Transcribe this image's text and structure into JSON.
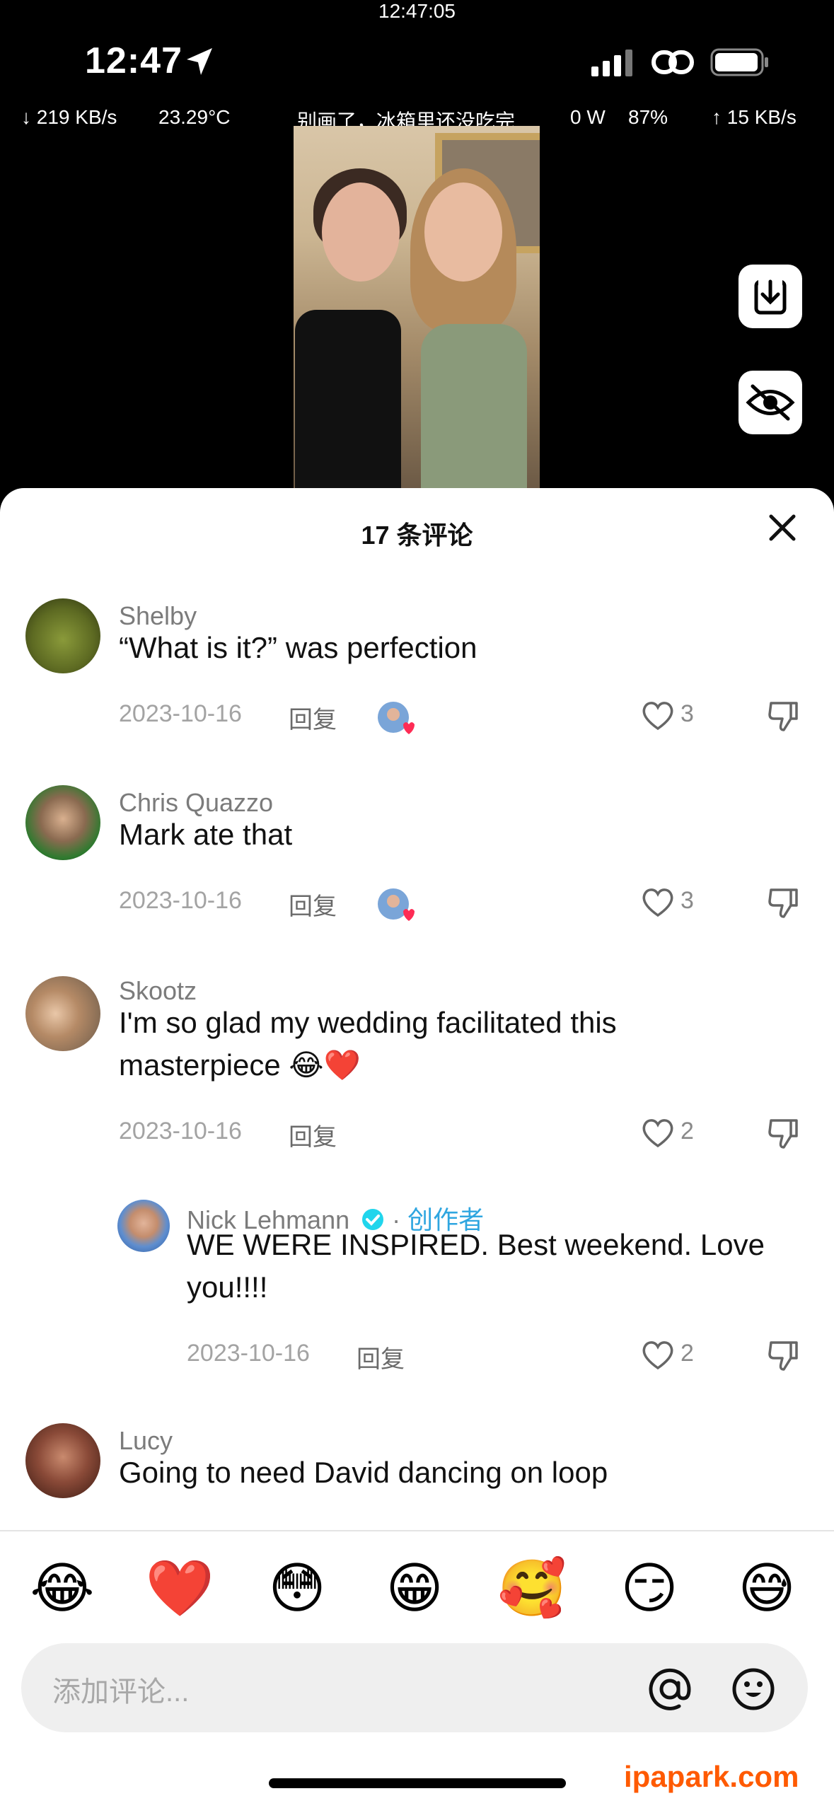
{
  "system_clock": "12:47:05",
  "status": {
    "time": "12:47",
    "location_icon": "location-arrow-icon"
  },
  "overlay": {
    "download_speed": "219 KB/s",
    "temperature": "23.29°C",
    "title": "别画了，冰箱里还没吃完",
    "power": "0 W",
    "battery_percent": "87%",
    "upload_speed": "15 KB/s"
  },
  "sheet": {
    "title": "17 条评论"
  },
  "comments": [
    {
      "user": "Shelby",
      "text": "“What is it?” was perfection",
      "date": "2023-10-16",
      "reply": "回复",
      "likes": "3"
    },
    {
      "user": "Chris Quazzo",
      "text": "Mark ate that",
      "date": "2023-10-16",
      "reply": "回复",
      "likes": "3"
    },
    {
      "user": "Skootz",
      "text": "I'm so glad my wedding facilitated this masterpiece 😂❤️",
      "date": "2023-10-16",
      "reply": "回复",
      "likes": "2"
    },
    {
      "user": "Nick Lehmann",
      "separator": "·",
      "creator_tag": "创作者",
      "text": "WE WERE INSPIRED. Best weekend. Love you!!!!",
      "date": "2023-10-16",
      "reply": "回复",
      "likes": "2"
    },
    {
      "user": "Lucy",
      "text": "Going to need David dancing on loop"
    }
  ],
  "emojis": [
    "😂",
    "❤️",
    "😳",
    "😁",
    "🥰",
    "😏",
    "😅"
  ],
  "input": {
    "placeholder": "添加评论..."
  },
  "watermark": "ipapark.com",
  "colors": {
    "creator_blue": "#2fa6e0",
    "like_red": "#fe2c55",
    "watermark": "#ff5a00"
  }
}
